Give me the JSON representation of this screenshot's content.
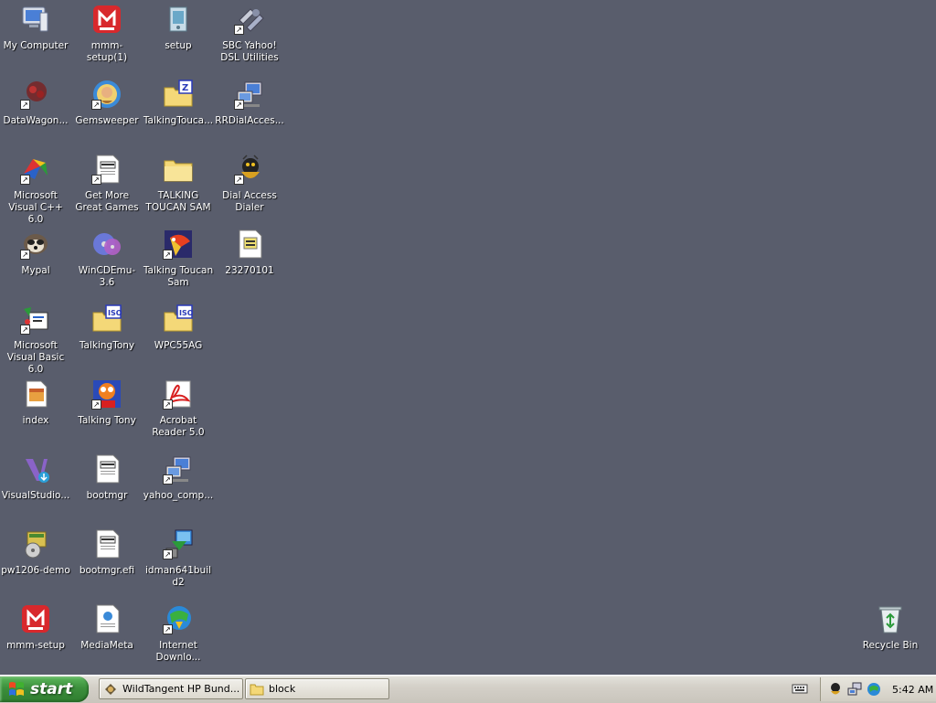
{
  "desktop": {
    "icons": [
      {
        "label": "My Computer",
        "icon": "my-computer-icon"
      },
      {
        "label": "DataWagon...",
        "icon": "datawagon-icon"
      },
      {
        "label": "Microsoft Visual C++ 6.0",
        "icon": "visual-cpp-icon"
      },
      {
        "label": "Mypal",
        "icon": "mypal-icon"
      },
      {
        "label": "Microsoft Visual Basic 6.0",
        "icon": "visual-basic-icon"
      },
      {
        "label": "index",
        "icon": "html-file-icon"
      },
      {
        "label": "VisualStudio...",
        "icon": "visual-studio-icon"
      },
      {
        "label": "pw1206-demo",
        "icon": "installer-icon"
      },
      {
        "label": "mmm-setup",
        "icon": "mmm-setup-icon"
      },
      {
        "label": "mmm-setup(1)",
        "icon": "mmm-setup-icon"
      },
      {
        "label": "Gemsweeper",
        "icon": "gemsweeper-icon"
      },
      {
        "label": "Get More Great Games",
        "icon": "document-icon"
      },
      {
        "label": "WinCDEmu-3.6",
        "icon": "cd-icon"
      },
      {
        "label": "TalkingTony",
        "icon": "iso-folder-icon"
      },
      {
        "label": "Talking Tony",
        "icon": "tony-icon"
      },
      {
        "label": "bootmgr",
        "icon": "system-file-icon"
      },
      {
        "label": "bootmgr.efi",
        "icon": "system-file-icon"
      },
      {
        "label": "MediaMeta",
        "icon": "media-file-icon"
      },
      {
        "label": "setup",
        "icon": "setup-icon"
      },
      {
        "label": "TalkingTouca...",
        "icon": "zip-folder-icon"
      },
      {
        "label": "TALKING TOUCAN SAM",
        "icon": "folder-icon"
      },
      {
        "label": "Talking Toucan Sam",
        "icon": "toucan-icon"
      },
      {
        "label": "WPC55AG",
        "icon": "iso-folder-icon"
      },
      {
        "label": "Acrobat Reader 5.0",
        "icon": "acrobat-icon"
      },
      {
        "label": "yahoo_comp...",
        "icon": "network-computer-icon"
      },
      {
        "label": "idman641build2",
        "icon": "idm-installer-icon"
      },
      {
        "label": "Internet Downlo...",
        "icon": "internet-download-icon"
      },
      {
        "label": "SBC Yahoo! DSL Utilities",
        "icon": "dsl-utilities-icon"
      },
      {
        "label": "RRDialAcces...",
        "icon": "network-computer-icon"
      },
      {
        "label": "Dial Access Dialer",
        "icon": "dialer-icon"
      },
      {
        "label": "23270101",
        "icon": "text-file-icon"
      },
      {
        "label": "Recycle Bin",
        "icon": "recycle-bin-icon"
      }
    ]
  },
  "taskbar": {
    "start_label": "start",
    "tasks": [
      {
        "label": "WildTangent HP Bund...",
        "icon": "wildtangent-icon"
      },
      {
        "label": "block",
        "icon": "folder-icon"
      }
    ],
    "clock": "5:42 AM"
  },
  "colors": {
    "desktop_bg": "#595d6c",
    "taskbar_bg": "#d4d0c8",
    "start_green": "#3c8f3c"
  }
}
